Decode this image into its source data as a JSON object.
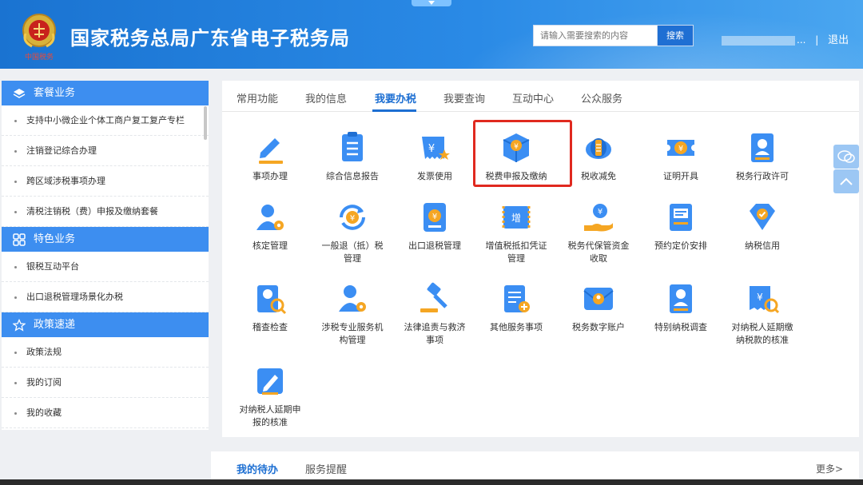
{
  "header": {
    "title": "国家税务总局广东省电子税务局",
    "emblem_text": "中国税务",
    "search_placeholder": "请输入需要搜索的内容",
    "search_button": "搜索",
    "user_suffix": "...",
    "separator": "|",
    "logout": "退出"
  },
  "sidebar": {
    "sections": [
      {
        "title": "套餐业务",
        "icon": "layers-icon",
        "items": [
          "支持中小微企业个体工商户复工复产专栏",
          "注销登记综合办理",
          "跨区域涉税事项办理",
          "清税注销税（费）申报及缴纳套餐"
        ]
      },
      {
        "title": "特色业务",
        "icon": "grid-icon",
        "items": [
          "银税互动平台",
          "出口退税管理场景化办税"
        ]
      },
      {
        "title": "政策速递",
        "icon": "star-icon",
        "items": [
          "政策法规",
          "我的订阅",
          "我的收藏"
        ]
      }
    ]
  },
  "tabs": [
    "常用功能",
    "我的信息",
    "我要办税",
    "我要查询",
    "互动中心",
    "公众服务"
  ],
  "active_tab": "我要办税",
  "tiles": [
    {
      "label": "事项办理",
      "icon": "pen-icon"
    },
    {
      "label": "综合信息报告",
      "icon": "document-list-icon"
    },
    {
      "label": "发票使用",
      "icon": "invoice-icon"
    },
    {
      "label": "税费申报及缴纳",
      "icon": "yuan-cube-icon"
    },
    {
      "label": "税收减免",
      "icon": "coins-icon"
    },
    {
      "label": "证明开具",
      "icon": "ticket-icon"
    },
    {
      "label": "税务行政许可",
      "icon": "certificate-icon"
    },
    {
      "label": "核定管理",
      "icon": "user-gear-icon"
    },
    {
      "label": "一般退（抵）税",
      "label2": "管理",
      "icon": "refund-icon"
    },
    {
      "label": "出口退税管理",
      "icon": "export-tablet-icon"
    },
    {
      "label": "增值税抵扣凭证",
      "label2": "管理",
      "icon": "vat-voucher-icon"
    },
    {
      "label": "税务代保管资金",
      "label2": "收取",
      "icon": "hand-money-icon"
    },
    {
      "label": "预约定价安排",
      "icon": "pricing-doc-icon"
    },
    {
      "label": "纳税信用",
      "icon": "credit-badge-icon"
    },
    {
      "label": "稽查检查",
      "icon": "inspect-icon"
    },
    {
      "label": "涉税专业服务机",
      "label2": "构管理",
      "icon": "agency-user-icon"
    },
    {
      "label": "法律追责与救济",
      "label2": "事项",
      "icon": "gavel-icon"
    },
    {
      "label": "其他服务事项",
      "icon": "clipboard-add-icon"
    },
    {
      "label": "税务数字账户",
      "icon": "digital-account-icon"
    },
    {
      "label": "特别纳税调查",
      "icon": "special-survey-icon"
    },
    {
      "label": "对纳税人延期缴",
      "label2": "纳税款的核准",
      "icon": "delay-payment-icon"
    },
    {
      "label": "对纳税人延期申",
      "label2": "报的核准",
      "icon": "delay-declare-icon"
    }
  ],
  "bottom": {
    "tabs": [
      "我的待办",
      "服务提醒"
    ],
    "more": "更多>"
  },
  "colors": {
    "primary": "#1d6fd2",
    "header": "#2a8ae6",
    "highlight": "#e0291f",
    "icon_blue": "#3b8ef3",
    "icon_orange": "#f5a623"
  }
}
